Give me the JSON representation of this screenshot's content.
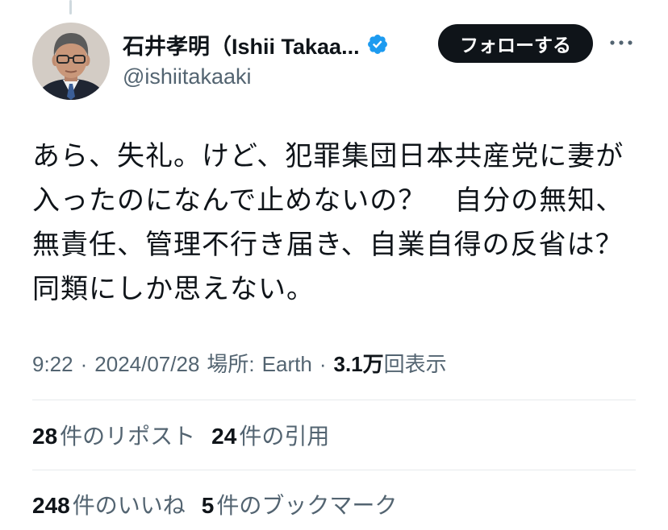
{
  "author": {
    "name": "石井孝明（Ishii Takaa...",
    "handle": "@ishiitakaaki",
    "verified": true,
    "avatar_icon": "avatar-photo",
    "badge_icon": "verified-badge-icon"
  },
  "actions": {
    "follow_label": "フォローする",
    "more_icon": "more-icon"
  },
  "tweet": {
    "text_lines": [
      "あら、失礼。けど、犯罪集団日本共産党に妻が",
      "入ったのになんで止めないの？　自分の無知、",
      "無責任、管理不行き届き、自業自得の反省は？",
      "同類にしか思えない。"
    ]
  },
  "meta": {
    "time": "9:22",
    "separator": "·",
    "date": "2024/07/28",
    "location_label": "場所:",
    "location": "Earth",
    "views_count": "3.1万",
    "views_label": "回表示"
  },
  "stats": {
    "reposts": {
      "count": "28",
      "label": "件のリポスト"
    },
    "quotes": {
      "count": "24",
      "label": "件の引用"
    },
    "likes": {
      "count": "248",
      "label": "件のいいね"
    },
    "bookmarks": {
      "count": "5",
      "label": "件のブックマーク"
    }
  },
  "colors": {
    "text": "#0f1419",
    "secondary_text": "#536471",
    "follow_button_bg": "#0f1419",
    "follow_button_text": "#ffffff",
    "verified_badge": "#1d9bf0",
    "divider": "#e6eaec"
  }
}
